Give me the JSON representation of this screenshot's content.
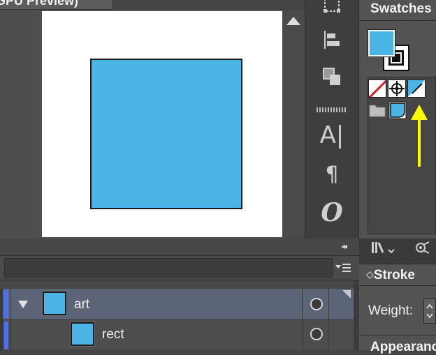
{
  "document": {
    "tab_title": "GPU Preview)"
  },
  "swatches_panel": {
    "title": "Swatches",
    "fill_color": "#4ab4e4",
    "stroke_color": "#111111",
    "swatches": [
      {
        "name": "None",
        "icon": "none-swatch"
      },
      {
        "name": "Registration",
        "icon": "registration-swatch"
      },
      {
        "name": "Color",
        "icon": "color-swatch"
      },
      {
        "name": "Color Group",
        "icon": "folder-icon"
      },
      {
        "name": "Group Color",
        "icon": "group-color-swatch"
      }
    ],
    "annotation_color": "#ffff00"
  },
  "tools": {
    "icons": [
      "transform-icon",
      "align-left-icon",
      "pathfinder-icon",
      "character-icon",
      "paragraph-icon",
      "opentype-icon"
    ],
    "character_glyph": "A|",
    "paragraph_glyph": "¶",
    "opentype_glyph": "O"
  },
  "stroke_panel": {
    "title": "Stroke",
    "weight_label": "Weight:"
  },
  "appearance_panel": {
    "title": "Appearance"
  },
  "layers_panel": {
    "collapse_glyph": "◂◂",
    "menu_glyph": "▾≡",
    "layers": [
      {
        "name": "art",
        "expanded": true,
        "color": "#4c6ff5"
      },
      {
        "name": "rect",
        "color": "#4c6ff5"
      }
    ]
  },
  "artwork": {
    "rect_fill": "#4ab4e4",
    "rect_stroke": "#1a1a1a"
  }
}
